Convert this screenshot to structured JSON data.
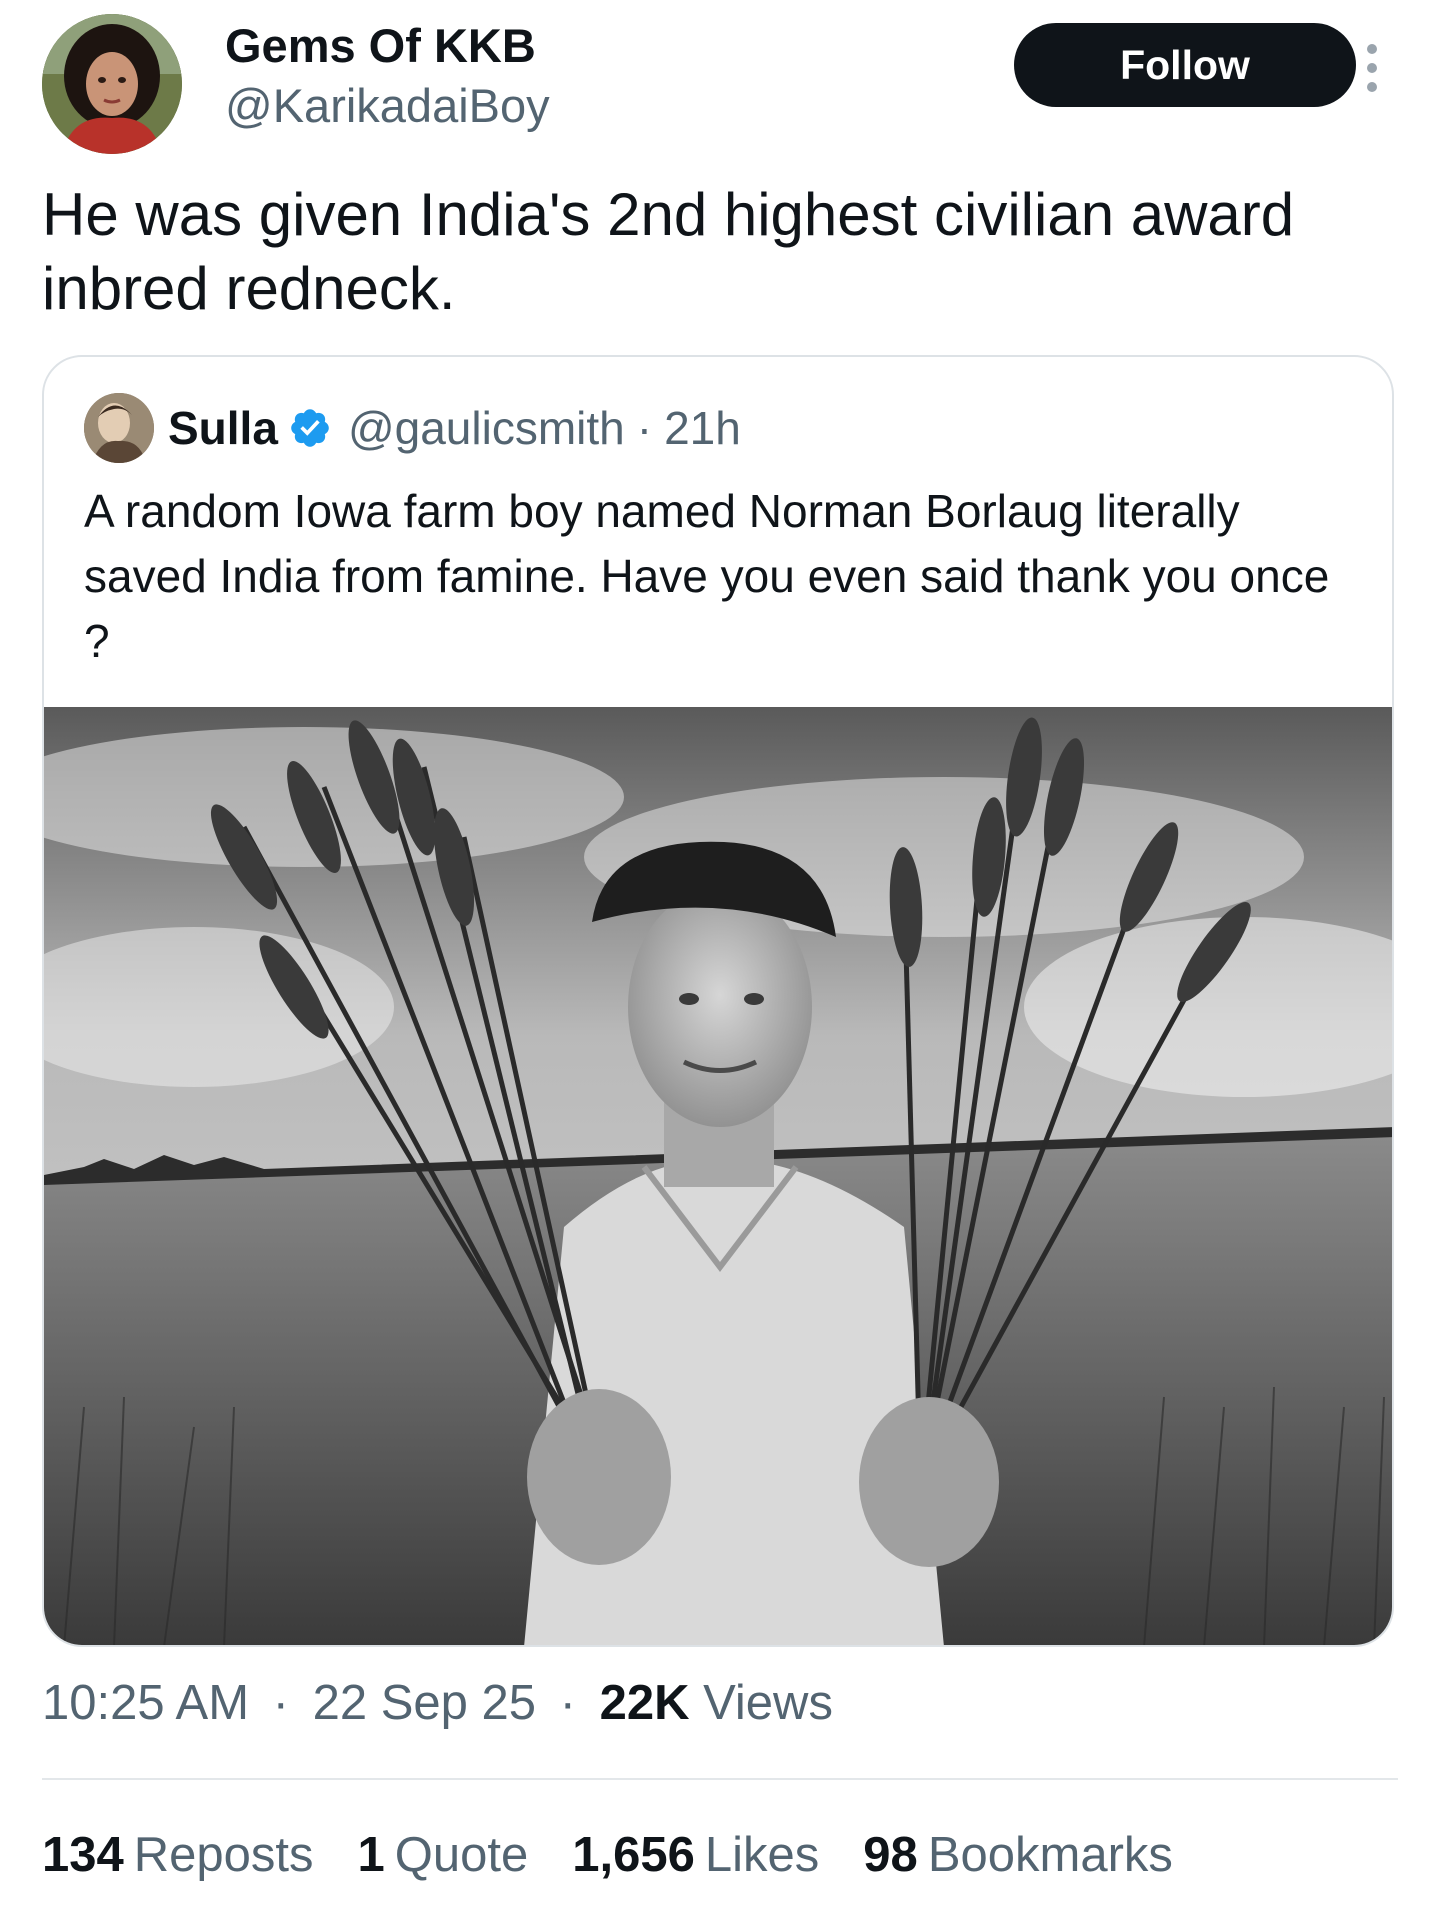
{
  "author": {
    "name": "Gems Of KKB",
    "handle": "@KarikadaiBoy"
  },
  "follow_label": "Follow",
  "tweet_text": "He was given India's 2nd highest civilian award inbred redneck.",
  "quoted": {
    "name": "Sulla",
    "handle": "@gaulicsmith",
    "separator": "·",
    "time": "21h",
    "text": "A random Iowa farm boy named Norman Borlaug literally saved India from famine. Have you even said thank you once ?"
  },
  "meta": {
    "time": "10:25 AM",
    "separator": "·",
    "date": "22 Sep 25",
    "views_count": "22K",
    "views_label": "Views"
  },
  "stats": [
    {
      "count": "134",
      "label": "Reposts"
    },
    {
      "count": "1",
      "label": "Quote"
    },
    {
      "count": "1,656",
      "label": "Likes"
    },
    {
      "count": "98",
      "label": "Bookmarks"
    }
  ],
  "colors": {
    "text_primary": "#0f1419",
    "text_secondary": "#536471",
    "follow_bg": "#0f1419",
    "verified": "#1d9bf0",
    "border": "#dde2e6"
  },
  "icons": {
    "more": "more-options-icon",
    "verified": "verified-badge-icon"
  }
}
